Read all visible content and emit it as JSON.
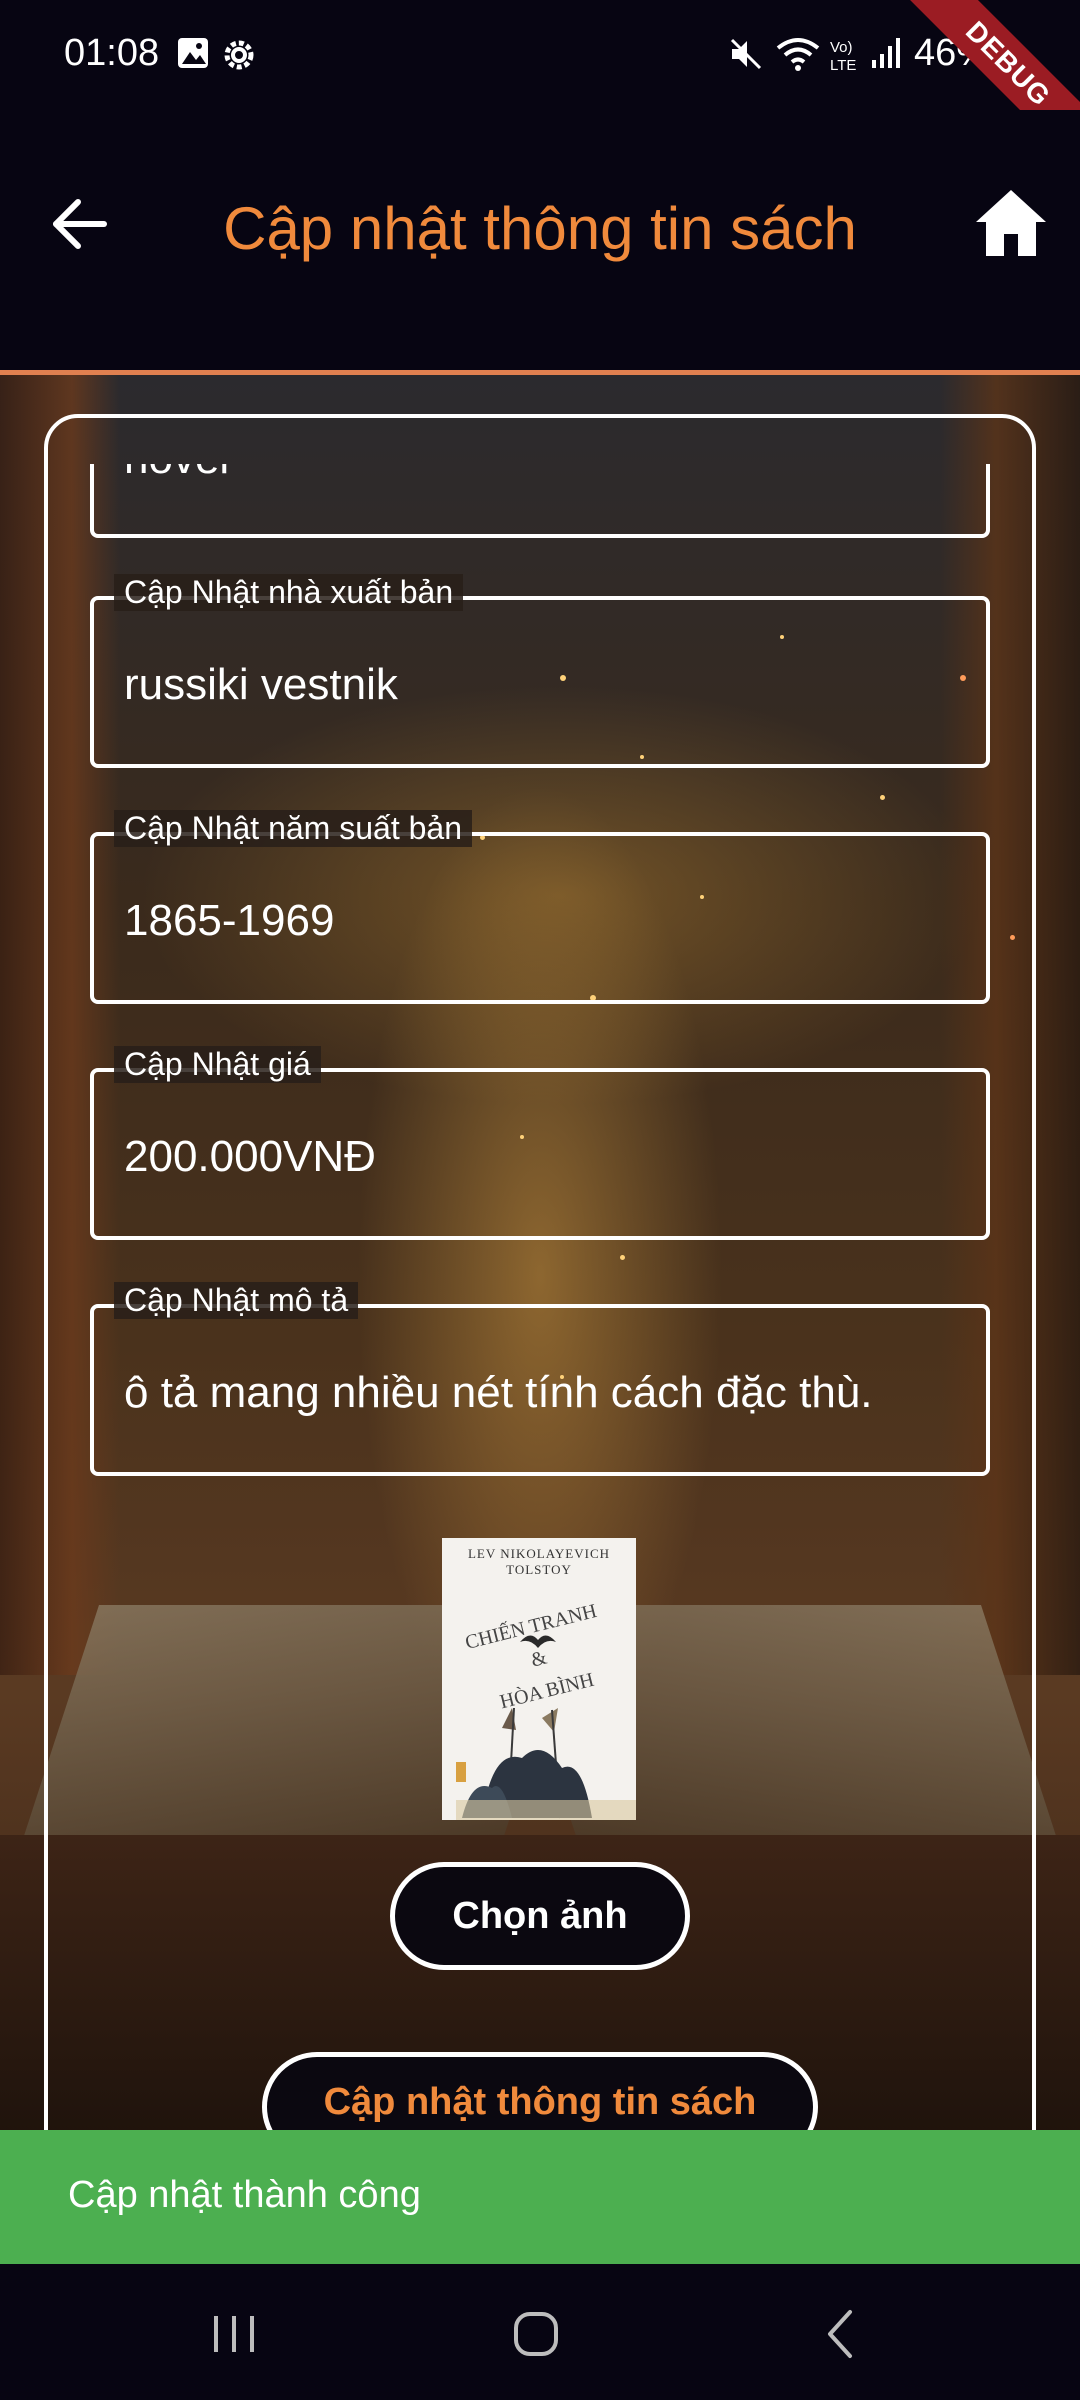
{
  "status_bar": {
    "time": "01:08",
    "battery": "46%",
    "debug_banner": "DEBUG",
    "icons": [
      "image-icon",
      "settings-gear-icon",
      "mute-icon",
      "wifi-icon",
      "volte-icon",
      "signal-icon",
      "battery-icon"
    ]
  },
  "app_bar": {
    "title": "Cập nhật thông tin sách",
    "back_icon": "arrow-left-icon",
    "home_icon": "home-icon",
    "accent_color": "#f08a3c"
  },
  "form": {
    "partial_field_value": "novel",
    "fields": [
      {
        "label": "Cập Nhật nhà xuất bản",
        "value": "russiki vestnik"
      },
      {
        "label": "Cập Nhật năm suất bản",
        "value": "1865-1969"
      },
      {
        "label": "Cập Nhật giá",
        "value": "200.000VNĐ"
      },
      {
        "label": "Cập Nhật mô tả",
        "value": "ô tả mang nhiều nét  tính cách đặc thù."
      }
    ]
  },
  "book_cover": {
    "author": "LEV NIKOLAYEVICH TOLSTOY",
    "title_line1": "CHIẾN TRANH",
    "title_line2": "&",
    "title_line3": "HÒA BÌNH"
  },
  "buttons": {
    "choose_image": "Chọn ảnh",
    "update_book": "Cập nhật thông tin sách"
  },
  "snackbar": {
    "message": "Cập nhật thành công",
    "color": "#4caf50"
  },
  "nav_bar": {
    "icons": [
      "recent-apps-icon",
      "home-circle-icon",
      "back-chevron-icon"
    ]
  }
}
